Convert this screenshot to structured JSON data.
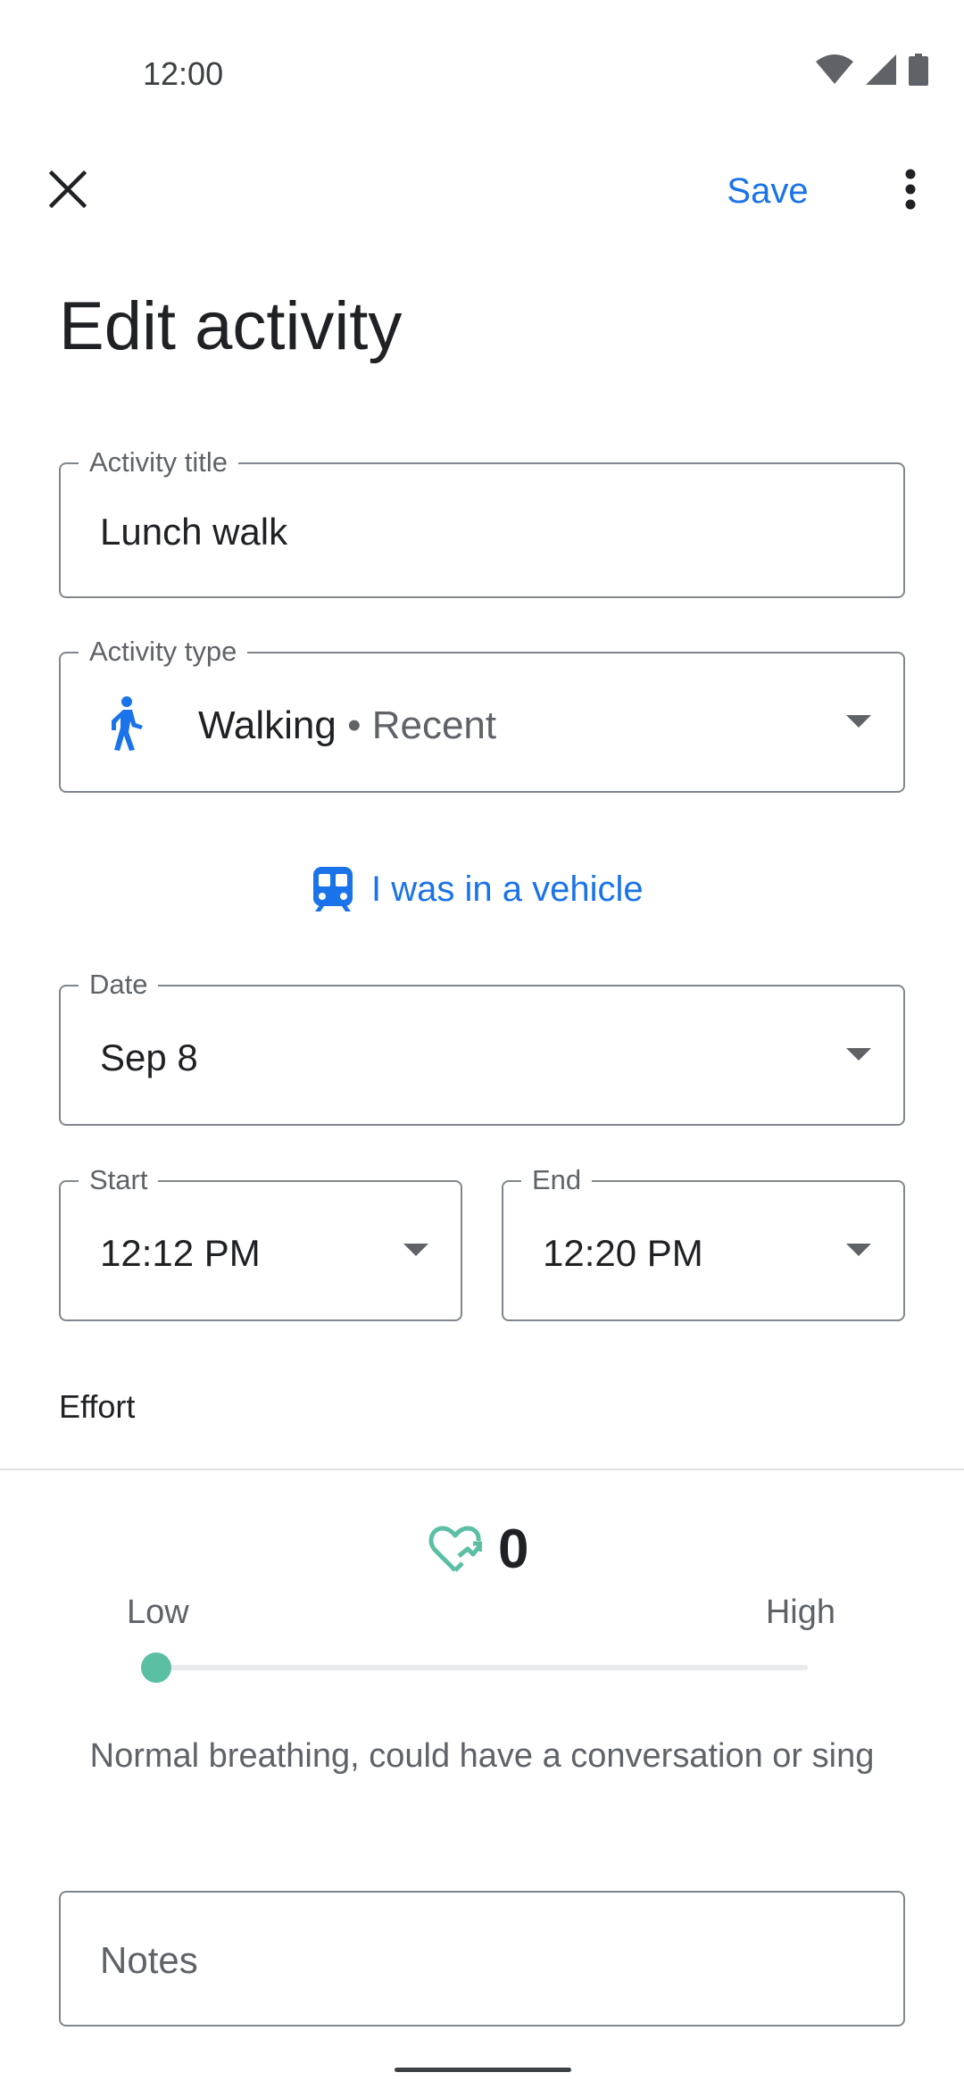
{
  "status_bar": {
    "time": "12:00"
  },
  "app_bar": {
    "save_label": "Save"
  },
  "page": {
    "title": "Edit activity"
  },
  "form": {
    "activity_title": {
      "label": "Activity title",
      "value": "Lunch walk"
    },
    "activity_type": {
      "label": "Activity type",
      "value": "Walking",
      "suffix": " • Recent",
      "icon": "walking-person-icon"
    },
    "vehicle_link": {
      "label": "I was in a vehicle",
      "icon": "train-icon"
    },
    "date": {
      "label": "Date",
      "value": "Sep 8"
    },
    "start": {
      "label": "Start",
      "value": "12:12 PM"
    },
    "end": {
      "label": "End",
      "value": "12:20 PM"
    }
  },
  "effort": {
    "section_title": "Effort",
    "value": "0",
    "low_label": "Low",
    "high_label": "High",
    "slider_level": 0,
    "description": "Normal breathing, could have a conversation or sing",
    "icon": "heart-trending-icon",
    "accent_color": "#5bbfa4"
  },
  "notes": {
    "placeholder": "Notes"
  },
  "colors": {
    "primary": "#1a73e8",
    "text": "#202124",
    "secondary_text": "#5f6368",
    "outline": "#80868b"
  }
}
